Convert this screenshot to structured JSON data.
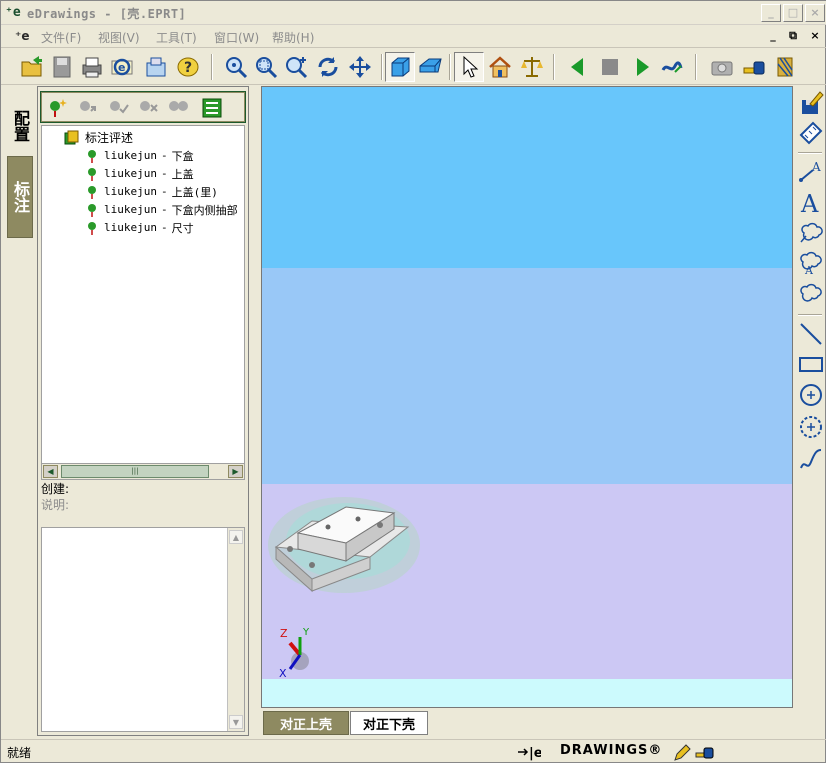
{
  "window": {
    "title": "eDrawings - [壳.EPRT]",
    "app_icon": "edrawings-logo"
  },
  "menu": [
    {
      "label": "文件(F)"
    },
    {
      "label": "视图(V)"
    },
    {
      "label": "工具(T)"
    },
    {
      "label": "窗口(W)"
    },
    {
      "label": "帮助(H)"
    }
  ],
  "left_tabs": {
    "config": "配置",
    "markup": "标注"
  },
  "markup_tree": {
    "root": "标注评述",
    "items": [
      {
        "author": "liukejun",
        "text": "下盒"
      },
      {
        "author": "liukejun",
        "text": "上盖"
      },
      {
        "author": "liukejun",
        "text": "上盖(里)"
      },
      {
        "author": "liukejun",
        "text": "下盒内侧抽部"
      },
      {
        "author": "liukejun",
        "text": "尺寸"
      }
    ]
  },
  "meta": {
    "created_label": "创建:",
    "desc_label": "说明:"
  },
  "view_tabs": [
    {
      "label": "对正上壳",
      "active": true
    },
    {
      "label": "对正下壳",
      "active": false
    }
  ],
  "status": {
    "text": "就绪",
    "brand": "DRAWINGS®"
  },
  "viewport": {
    "colors": [
      "#68c6fb",
      "#99c8f7",
      "#ccc8f4",
      "#ccfafd"
    ],
    "triad_axes": [
      "Z",
      "Y",
      "X"
    ]
  }
}
